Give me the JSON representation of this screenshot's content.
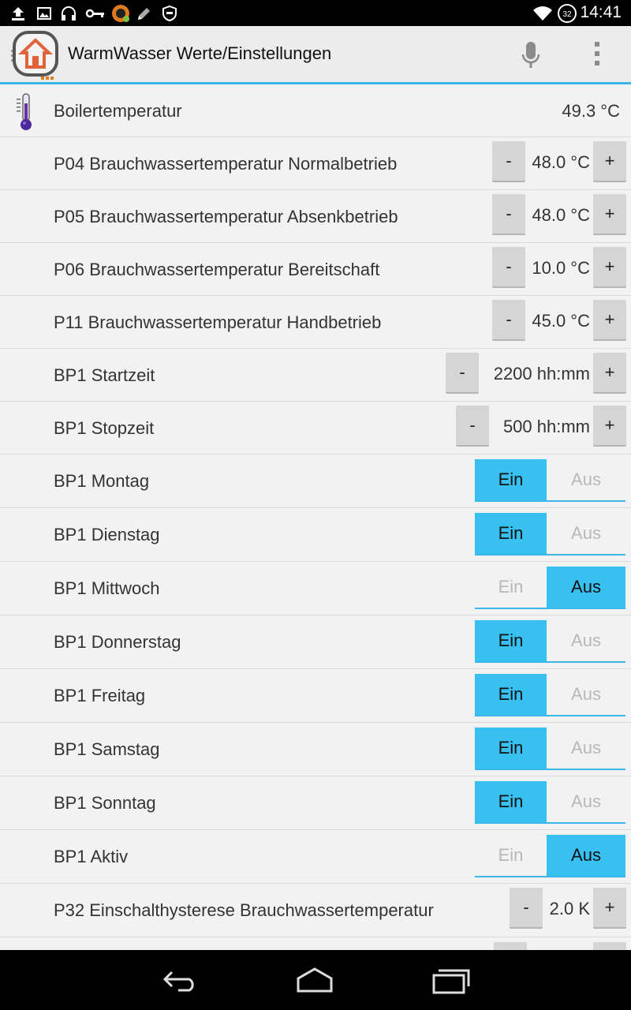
{
  "status_bar": {
    "time": "14:41",
    "battery_level": "32",
    "icons_left": [
      "upload-icon",
      "image-icon",
      "headset-icon",
      "key-icon",
      "app-notification-icon",
      "edit-icon",
      "shield-icon"
    ],
    "icons_right": [
      "wifi-icon",
      "battery-icon"
    ]
  },
  "action_bar": {
    "title": "WarmWasser Werte/Einstellungen",
    "accent_color": "#38b7e8"
  },
  "rows": [
    {
      "type": "value",
      "label": "Boilertemperatur",
      "value": "49.3 °C",
      "icon": "thermometer-icon"
    },
    {
      "type": "stepper",
      "label": "P04 Brauchwassertemperatur Normalbetrieb",
      "value": "48.0 °C",
      "minus": "-",
      "plus": "+"
    },
    {
      "type": "stepper",
      "label": "P05 Brauchwassertemperatur Absenkbetrieb",
      "value": "48.0 °C",
      "minus": "-",
      "plus": "+"
    },
    {
      "type": "stepper",
      "label": "P06 Brauchwassertemperatur Bereitschaft",
      "value": "10.0 °C",
      "minus": "-",
      "plus": "+"
    },
    {
      "type": "stepper",
      "label": "P11 Brauchwassertemperatur Handbetrieb",
      "value": "45.0 °C",
      "minus": "-",
      "plus": "+"
    },
    {
      "type": "stepper",
      "label": "BP1 Startzeit",
      "value": "2200 hh:mm",
      "minus": "-",
      "plus": "+"
    },
    {
      "type": "stepper",
      "label": "BP1 Stopzeit",
      "value": "500 hh:mm",
      "minus": "-",
      "plus": "+"
    },
    {
      "type": "toggle",
      "label": "BP1 Montag",
      "on_label": "Ein",
      "off_label": "Aus",
      "state": "Ein"
    },
    {
      "type": "toggle",
      "label": "BP1 Dienstag",
      "on_label": "Ein",
      "off_label": "Aus",
      "state": "Ein"
    },
    {
      "type": "toggle",
      "label": "BP1 Mittwoch",
      "on_label": "Ein",
      "off_label": "Aus",
      "state": "Aus"
    },
    {
      "type": "toggle",
      "label": "BP1 Donnerstag",
      "on_label": "Ein",
      "off_label": "Aus",
      "state": "Ein"
    },
    {
      "type": "toggle",
      "label": "BP1 Freitag",
      "on_label": "Ein",
      "off_label": "Aus",
      "state": "Ein"
    },
    {
      "type": "toggle",
      "label": "BP1 Samstag",
      "on_label": "Ein",
      "off_label": "Aus",
      "state": "Ein"
    },
    {
      "type": "toggle",
      "label": "BP1 Sonntag",
      "on_label": "Ein",
      "off_label": "Aus",
      "state": "Ein"
    },
    {
      "type": "toggle",
      "label": "BP1 Aktiv",
      "on_label": "Ein",
      "off_label": "Aus",
      "state": "Aus"
    },
    {
      "type": "stepper",
      "label": "P32 Einschalthysterese Brauchwassertemperatur",
      "value": "2.0 K",
      "minus": "-",
      "plus": "+"
    }
  ],
  "colors": {
    "toggle_active": "#38c0f1",
    "toggle_inactive_text": "#b8b8b8",
    "button_bg": "#d5d5d5"
  },
  "nav_bar": {
    "buttons": [
      "back-icon",
      "home-icon",
      "recent-apps-icon"
    ]
  }
}
